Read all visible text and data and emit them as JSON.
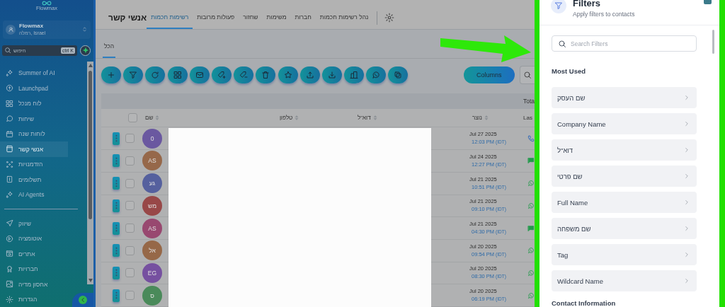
{
  "sidebar": {
    "logo_text": "Flowmax",
    "account": {
      "name": "Flowmax",
      "location": "רמלה, Israel"
    },
    "search": {
      "placeholder": "חיפוש",
      "shortcut": "ctrl K"
    },
    "primary_items": [
      {
        "label": "Summer of AI",
        "selected": false
      },
      {
        "label": "Launchpad",
        "selected": false
      },
      {
        "label": "לוח מנכל",
        "selected": false
      },
      {
        "label": "שיחות",
        "selected": false
      },
      {
        "label": "לוחות שנה",
        "selected": false
      },
      {
        "label": "אנשי קשר",
        "selected": true
      },
      {
        "label": "הזדמנויות",
        "selected": false
      },
      {
        "label": "תשלומים",
        "selected": false
      },
      {
        "label": "AI Agents",
        "selected": false
      }
    ],
    "secondary_items": [
      {
        "label": "שיווק",
        "selected": false
      },
      {
        "label": "אוטומציה",
        "selected": false
      },
      {
        "label": "אתרים",
        "selected": false
      },
      {
        "label": "חברויות",
        "selected": false
      },
      {
        "label": "אחסון מדיה",
        "selected": false
      },
      {
        "label": "הגדרות",
        "selected": false
      }
    ]
  },
  "header": {
    "tabs": [
      {
        "label": "נהל רשימות חכמות",
        "selected": false
      },
      {
        "label": "חברות",
        "selected": false
      },
      {
        "label": "משימות",
        "selected": false
      },
      {
        "label": "שחזור",
        "selected": false
      },
      {
        "label": "פעולות מרובות",
        "selected": false
      },
      {
        "label": "רשימות חכמות",
        "selected": true
      }
    ],
    "title": "אנשי קשר",
    "subtabs": [
      {
        "label": "הכל",
        "selected": true
      }
    ]
  },
  "toolbar": {
    "columns_button": "Columns"
  },
  "table": {
    "total_label": "Tota",
    "select_all_checked": false,
    "columns": [
      "Las",
      "נוצר",
      "דוא\"ל",
      "טלפון",
      "שם"
    ],
    "rows": [
      {
        "kind": "phone",
        "date": "Jul 27 2025",
        "time": "12:03 PM",
        "timezone": "(IDT)",
        "initials": "0",
        "color": "#6a58a0",
        "checked": false
      },
      {
        "kind": "sms",
        "date": "Jul 24 2025",
        "time": "12:27 PM",
        "timezone": "(IDT)",
        "initials": "AS",
        "color": "#96684a",
        "checked": false
      },
      {
        "kind": "whatsapp",
        "date": "Jul 21 2025",
        "time": "10:51 PM",
        "timezone": "(IDT)",
        "initials": "גע",
        "color": "#55609e",
        "checked": false
      },
      {
        "kind": "whatsapp",
        "date": "Jul 21 2025",
        "time": "09:10 PM",
        "timezone": "(IDT)",
        "initials": "מש",
        "color": "#984848",
        "checked": false
      },
      {
        "kind": "sms",
        "date": "Jul 21 2025",
        "time": "04:30 PM",
        "timezone": "(IDT)",
        "initials": "AS",
        "color": "#984870",
        "checked": false
      },
      {
        "kind": "whatsapp",
        "date": "Jul 20 2025",
        "time": "09:54 PM",
        "timezone": "(IDT)",
        "initials": "אל",
        "color": "#966848",
        "checked": false
      },
      {
        "kind": "whatsapp",
        "date": "Jul 20 2025",
        "time": "08:30 PM",
        "timezone": "(IDT)",
        "initials": "EG",
        "color": "#7650a0",
        "checked": false
      },
      {
        "kind": "whatsapp",
        "date": "Jul 20 2025",
        "time": "06:19 PM",
        "timezone": "(IDT)",
        "initials": "ס",
        "color": "#4a8a5a",
        "checked": false
      }
    ]
  },
  "filters": {
    "title": "Filters",
    "subtitle": "Apply filters to contacts",
    "search": {
      "placeholder": "Search Filters"
    },
    "section": "Most Used",
    "items": [
      "שם העסק",
      "Company Name",
      "דוא\"ל",
      "שם פרטי",
      "Full Name",
      "שם משפחה",
      "Tag",
      "Wildcard Name"
    ],
    "next_section": "Contact Information"
  }
}
